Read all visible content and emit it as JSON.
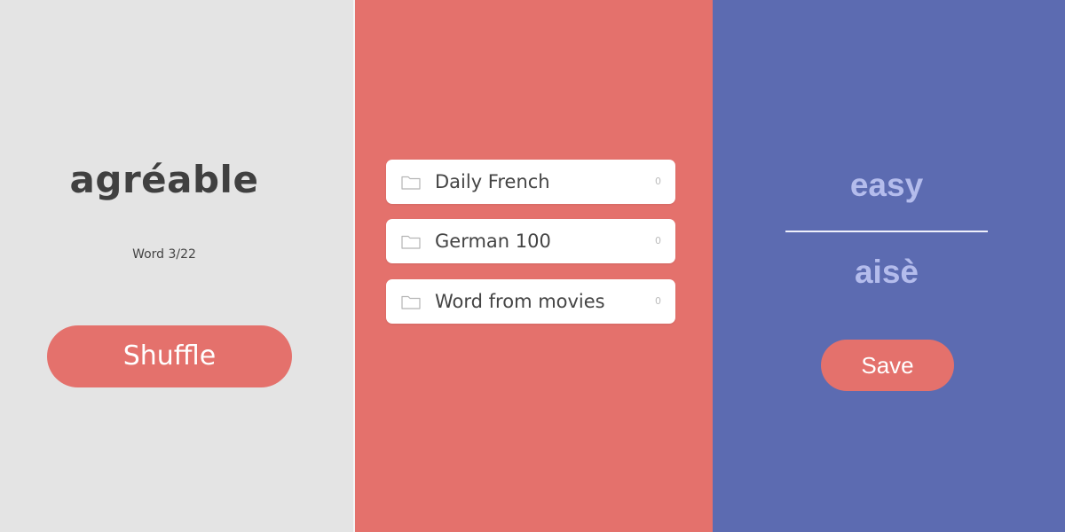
{
  "left": {
    "word": "agréable",
    "counter": "Word 3/22",
    "shuffle_label": "Shuffle"
  },
  "list": {
    "items": [
      {
        "icon": "folder-icon",
        "label": "Daily French",
        "count": "0"
      },
      {
        "icon": "folder-icon",
        "label": "German 100",
        "count": "0"
      },
      {
        "icon": "folder-icon",
        "label": "Word from movies",
        "count": "0"
      }
    ]
  },
  "right": {
    "translation_top": "easy",
    "translation_bottom": "aisè",
    "save_label": "Save"
  },
  "colors": {
    "left_bg": "#e4e4e4",
    "mid_bg": "#e4716c",
    "right_bg": "#5c6bb1",
    "accent": "#e4716c",
    "translation_text": "#b4bcec"
  }
}
